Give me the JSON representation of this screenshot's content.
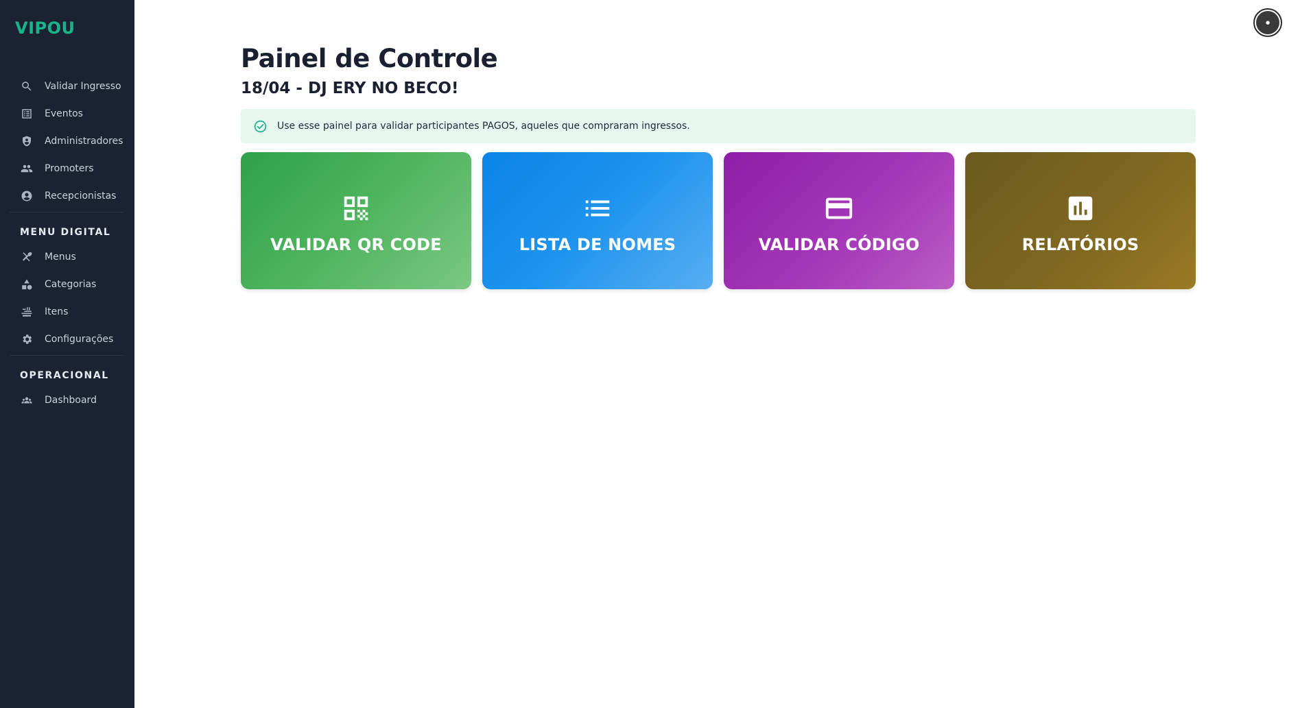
{
  "brand": "VIPOU",
  "sidebar": {
    "items": [
      {
        "label": "Validar Ingresso",
        "icon": "search-icon"
      },
      {
        "label": "Eventos",
        "icon": "list-icon"
      },
      {
        "label": "Administradores",
        "icon": "admin-shield-icon"
      },
      {
        "label": "Promoters",
        "icon": "people-icon"
      },
      {
        "label": "Recepcionistas",
        "icon": "account-circle-icon"
      }
    ],
    "section_menu_digital": "MENU DIGITAL",
    "menu_items": [
      {
        "label": "Menus",
        "icon": "utensils-icon"
      },
      {
        "label": "Categorias",
        "icon": "shapes-icon"
      },
      {
        "label": "Itens",
        "icon": "food-tray-icon"
      },
      {
        "label": "Configurações",
        "icon": "gear-icon"
      }
    ],
    "section_operacional": "OPERACIONAL",
    "operacional_items": [
      {
        "label": "Dashboard",
        "icon": "groups-icon"
      }
    ]
  },
  "main": {
    "title": "Painel de Controle",
    "event": "18/04 - DJ ERY NO BECO!",
    "alert": "Use esse painel para validar participantes PAGOS, aqueles que compraram ingressos.",
    "cards": [
      {
        "label": "VALIDAR QR CODE",
        "icon": "qr-code-icon"
      },
      {
        "label": "LISTA DE NOMES",
        "icon": "list-bullets-icon"
      },
      {
        "label": "VALIDAR CÓDIGO",
        "icon": "credit-card-icon"
      },
      {
        "label": "RELATÓRIOS",
        "icon": "bar-chart-icon"
      }
    ]
  },
  "colors": {
    "sidebar_bg": "#1b2232",
    "brand": "#1bb38a",
    "alert_bg": "#e8f6f0",
    "card_green": "#4caf50",
    "card_blue": "#1e88e5",
    "card_purple": "#9c27b0",
    "card_gold": "#7e6720"
  }
}
